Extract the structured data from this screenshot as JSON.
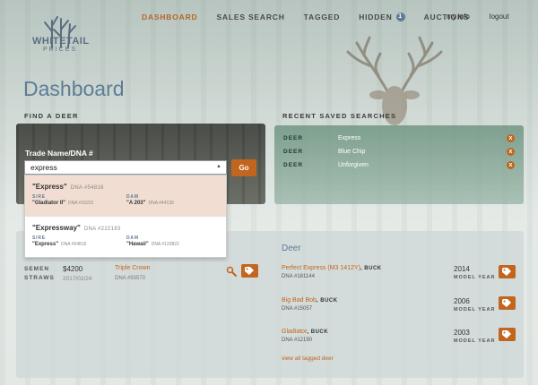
{
  "brand": {
    "name": "WHITETAIL",
    "sub": "PRICES"
  },
  "nav": {
    "dashboard": "DASHBOARD",
    "sales_search": "SALES SEARCH",
    "tagged": "TAGGED",
    "hidden": "HIDDEN",
    "hidden_count": "1",
    "auctions": "AUCTIONS",
    "my_info": "my info",
    "logout": "logout"
  },
  "page_title": "Dashboard",
  "find": {
    "heading": "FIND A DEER",
    "field_label": "Trade Name/DNA #",
    "value": "express",
    "go": "Go",
    "suggestions": [
      {
        "name": "\"Express\"",
        "dna": "DNA #54816",
        "sire_label": "SIRE",
        "sire": "\"Gladiator II\"",
        "sire_dna": "DNA #15201",
        "dam_label": "DAM",
        "dam": "\"A 203\"",
        "dam_dna": "DNA #44139"
      },
      {
        "name": "\"Expressway\"",
        "dna": "DNA #222193",
        "sire_label": "SIRE",
        "sire": "\"Express\"",
        "sire_dna": "DNA #54816",
        "dam_label": "DAM",
        "dam": "\"Hawaii\"",
        "dam_dna": "DNA #120822"
      }
    ]
  },
  "recent": {
    "heading": "RECENT SAVED SEARCHES",
    "items": [
      {
        "key": "DEER",
        "value": "Express"
      },
      {
        "key": "DEER",
        "value": "Blue Chip"
      },
      {
        "key": "DEER",
        "value": "Unforgiven"
      }
    ],
    "remove_icon": "x"
  },
  "semen": {
    "label_1": "SEMEN",
    "label_2": "STRAWS",
    "price": "$4200",
    "date": "2017/02/24",
    "name": "Triple Crown",
    "dna": "DNA #93570"
  },
  "deer": {
    "heading": "Deer",
    "model_year_label": "MODEL YEAR",
    "rows": [
      {
        "name": "Perfect Express (M3 1412Y)",
        "sex": ", BUCK",
        "dna": "DNA #181144",
        "year": "2014"
      },
      {
        "name": "Big Bad Bob",
        "sex": ", BUCK",
        "dna": "DNA #15057",
        "year": "2006"
      },
      {
        "name": "Gladiator",
        "sex": ", BUCK",
        "dna": "DNA #12190",
        "year": "2003"
      }
    ],
    "view_all": "view all tagged deer"
  },
  "colors": {
    "accent": "#c2651f",
    "brand_blue": "#5e7c96",
    "highlight": "#f1ddd2",
    "panel_green": "#7a9e8c"
  }
}
